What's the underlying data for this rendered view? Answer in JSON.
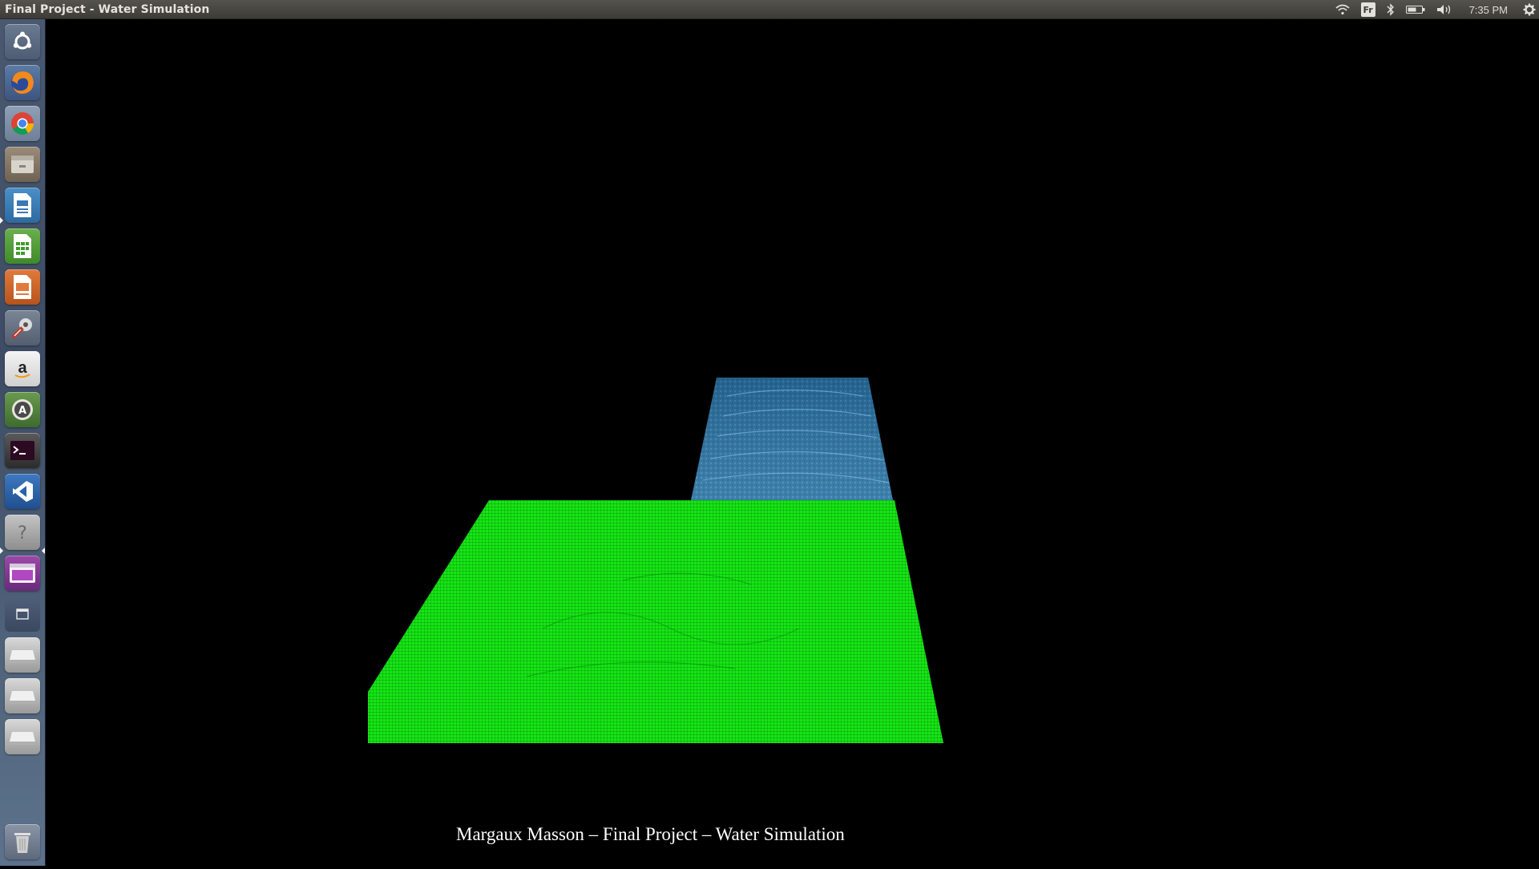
{
  "window": {
    "title": "Final Project - Water Simulation"
  },
  "panel": {
    "keyboard_layout": "Fr",
    "clock": "7:35 PM",
    "indicator_icons": [
      "wifi-icon",
      "keyboard-layout-indicator",
      "bluetooth-icon",
      "battery-icon",
      "volume-icon",
      "settings-gear-icon"
    ]
  },
  "launcher": {
    "items": [
      "ubuntu-dash-icon",
      "firefox-icon",
      "chrome-icon",
      "files-icon",
      "libreoffice-writer-icon",
      "libreoffice-calc-icon",
      "libreoffice-impress-icon",
      "system-settings-icon",
      "amazon-icon",
      "software-updater-icon",
      "terminal-icon",
      "vscode-icon",
      "help-icon",
      "workspace-switcher-icon",
      "window-icon",
      "drive-icon",
      "drive-icon",
      "drive-icon",
      "trash-icon"
    ]
  },
  "scene": {
    "caption": "Margaux Masson – Final Project – Water Simulation",
    "colors": {
      "water": "#2b6b9a",
      "mesh": "#14e014",
      "background": "#000000"
    }
  }
}
